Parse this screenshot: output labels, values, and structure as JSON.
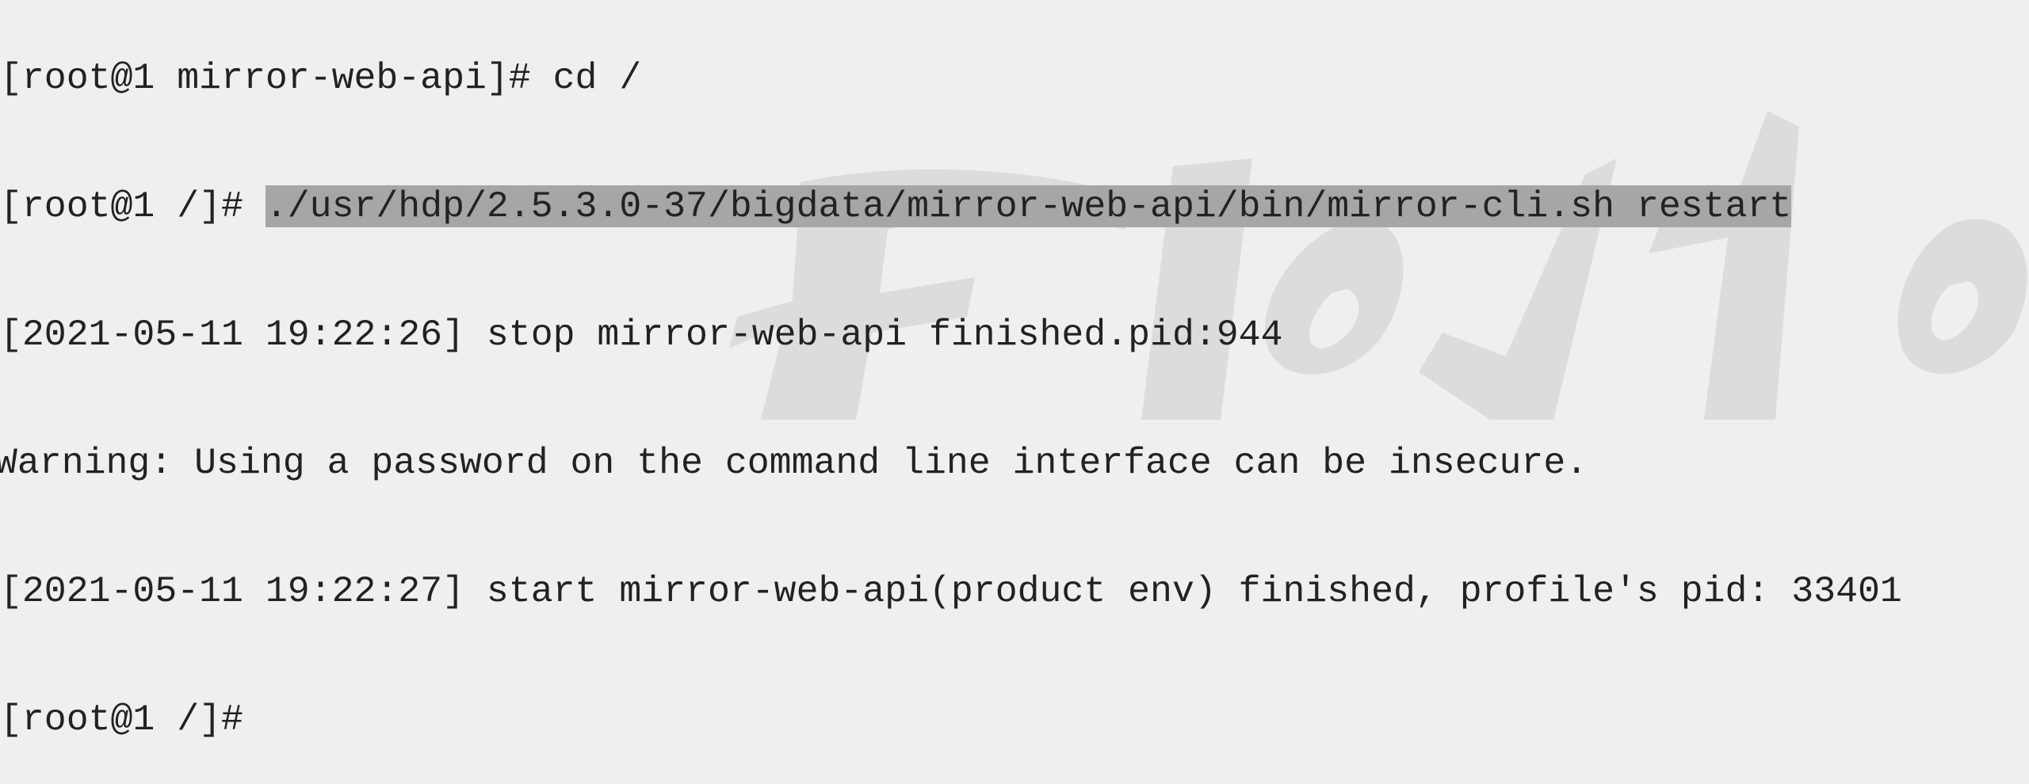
{
  "terminal": {
    "lines": {
      "prev_cmd": "[root@1 mirror-web-api]# cd /",
      "prompt": "[root@1 /]# ",
      "command": "./usr/hdp/2.5.3.0-37/bigdata/mirror-web-api/bin/mirror-cli.sh restart",
      "stop": "[2021-05-11 19:22:26] stop mirror-web-api finished.pid:944",
      "warning": "Warning: Using a password on the command line interface can be insecure.",
      "start": "[2021-05-11 19:22:27] start mirror-web-api(product env) finished, profile's pid: 33401",
      "final_prompt": "[root@1 /]#"
    }
  },
  "colors": {
    "background": "#efefef",
    "selection": "#a6a6a6",
    "text": "#222222"
  }
}
